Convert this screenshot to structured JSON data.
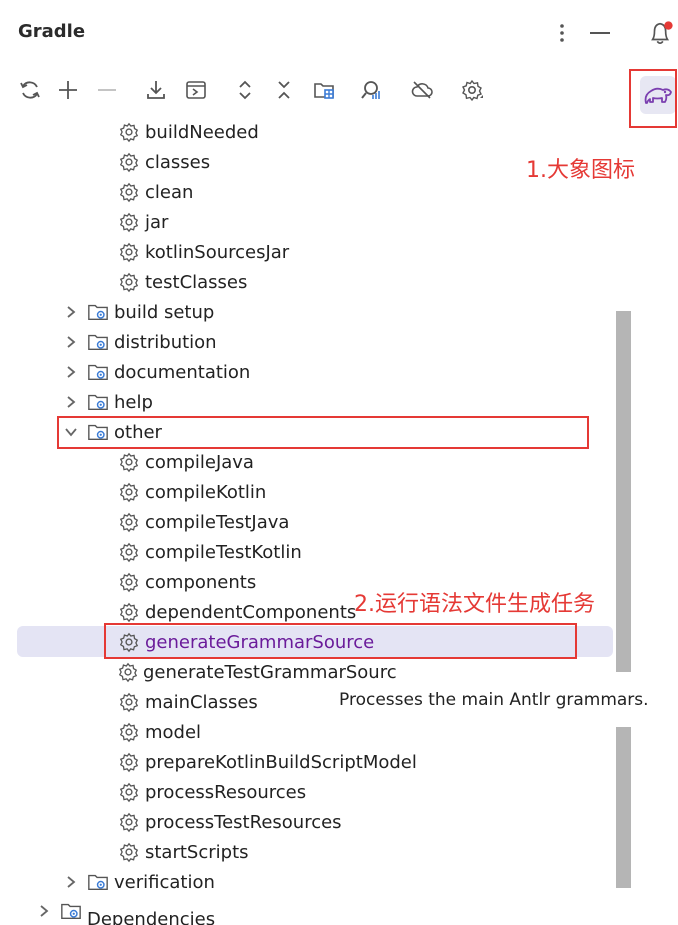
{
  "header": {
    "title": "Gradle"
  },
  "toolbar": {
    "buttons": [
      "refresh-icon",
      "add-icon",
      "remove-icon",
      "download-icon",
      "run-tasks-icon",
      "expand-all-icon",
      "collapse-all-icon",
      "project-structure-icon",
      "analyze-icon",
      "offline-icon",
      "settings-icon",
      "elephant-icon"
    ]
  },
  "tree": {
    "items_top": [
      "buildNeeded",
      "classes",
      "clean",
      "jar",
      "kotlinSourcesJar",
      "testClasses"
    ],
    "groups_collapsed": [
      "build setup",
      "distribution",
      "documentation",
      "help"
    ],
    "group_expanded": "other",
    "other_tasks": [
      "compileJava",
      "compileKotlin",
      "compileTestJava",
      "compileTestKotlin",
      "components",
      "dependentComponents",
      "generateGrammarSource",
      "generateTestGrammarSource",
      "mainClasses",
      "model",
      "prepareKotlinBuildScriptModel",
      "processResources",
      "processTestResources",
      "startScripts"
    ],
    "group_after": "verification",
    "root_after": "Dependencies"
  },
  "tooltip": {
    "text": "Processes the main Antlr grammars."
  },
  "annotations": {
    "a1": "1.大象图标",
    "a2": "2.运行语法文件生成任务"
  },
  "colors": {
    "accent_red": "#e53935",
    "selected_text": "#6a1b9a",
    "selected_bg": "#e4e4f4",
    "gear_blue": "#3a7bd5"
  }
}
